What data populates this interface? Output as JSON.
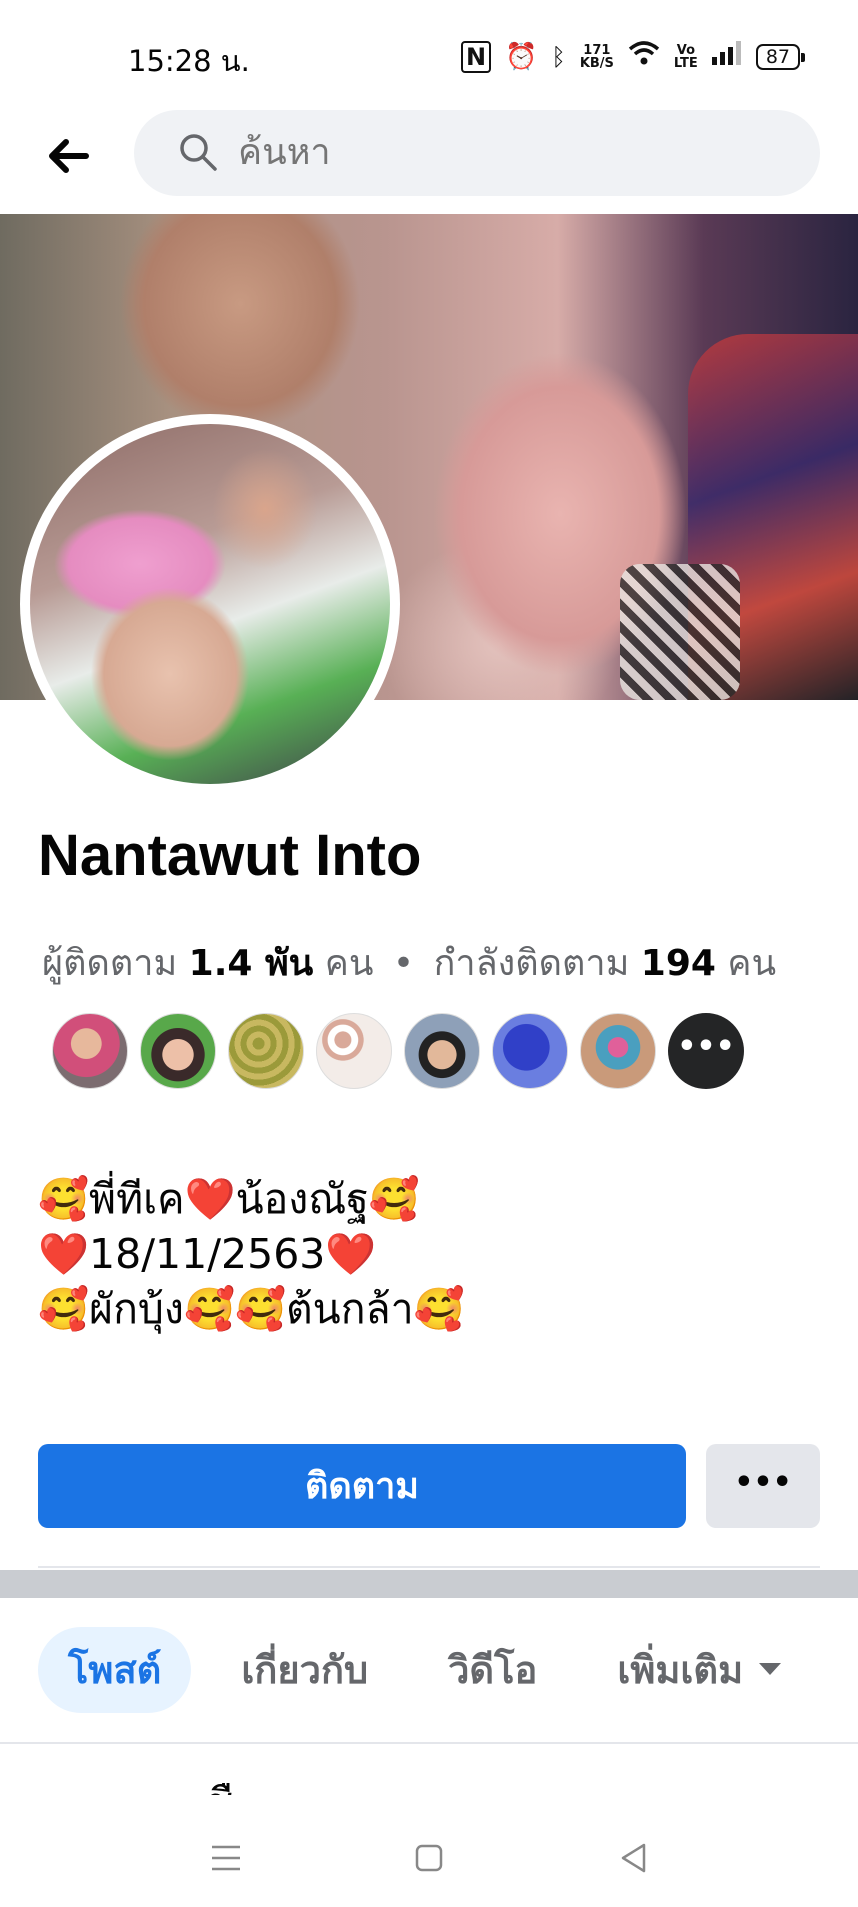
{
  "status_bar": {
    "time": "15:28 น.",
    "network_speed_value": "171",
    "network_speed_unit": "KB/S",
    "volte": "Vo",
    "volte_sub": "LTE",
    "battery": "87"
  },
  "header": {
    "search_placeholder": "ค้นหา"
  },
  "profile": {
    "name": "Nantawut Into",
    "followers_label": "ผู้ติดตาม",
    "followers_count": "1.4 พัน",
    "followers_unit": "คน",
    "separator": "•",
    "following_label": "กำลังติดตาม",
    "following_count": "194",
    "following_unit": "คน",
    "more_friends": "•••",
    "bio": "🥰พี่ทีเค❤️น้องณัฐ🥰\n❤️18/11/2563❤️\n🥰ผักบุ้ง🥰🥰ต้นกล้า🥰",
    "friend_colors": [
      "#c46a6a",
      "#6aa35c",
      "#b8a84a",
      "#eae2dc",
      "#7a8ea8",
      "#4a55c9",
      "#c99a7a"
    ]
  },
  "actions": {
    "follow": "ติดตาม",
    "more": "•••"
  },
  "tabs": [
    {
      "label": "โพสต์"
    },
    {
      "label": "เกี่ยวกับ"
    },
    {
      "label": "วิดีโอ"
    },
    {
      "label": "เพิ่มเติม"
    }
  ],
  "partial_text": "ชื"
}
